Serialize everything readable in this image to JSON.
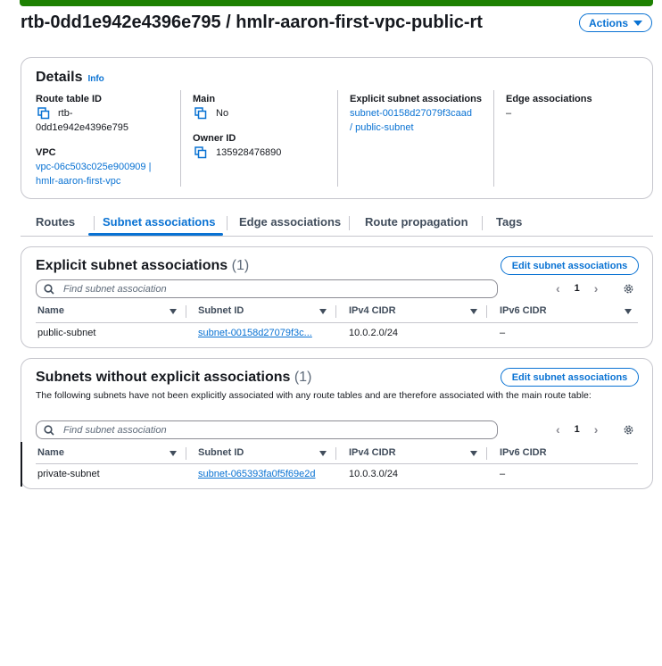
{
  "header": {
    "title": "rtb-0dd1e942e4396e795 / hmlr-aaron-first-vpc-public-rt",
    "actions_label": "Actions"
  },
  "details": {
    "heading": "Details",
    "info_label": "Info",
    "route_table_id_label": "Route table ID",
    "route_table_id_value_1": "rtb-",
    "route_table_id_value_2": "0dd1e942e4396e795",
    "vpc_label": "VPC",
    "vpc_value_1": "vpc-06c503c025e900909 |",
    "vpc_value_2": "hmlr-aaron-first-vpc",
    "main_label": "Main",
    "main_value": "No",
    "owner_id_label": "Owner ID",
    "owner_id_value": "135928476890",
    "explicit_label": "Explicit subnet associations",
    "explicit_value_1": "subnet-00158d27079f3caad",
    "explicit_value_2": "/ public-subnet",
    "edge_label": "Edge associations",
    "edge_value": "–"
  },
  "tabs": [
    "Routes",
    "Subnet associations",
    "Edge associations",
    "Route propagation",
    "Tags"
  ],
  "explicit_section": {
    "heading": "Explicit subnet associations",
    "count": "(1)",
    "edit_button": "Edit subnet associations",
    "search_placeholder": "Find subnet association",
    "page": "1",
    "columns": [
      "Name",
      "Subnet ID",
      "IPv4 CIDR",
      "IPv6 CIDR"
    ],
    "rows": [
      {
        "name": "public-subnet",
        "subnet_id": "subnet-00158d27079f3c...",
        "ipv4": "10.0.2.0/24",
        "ipv6": "–"
      }
    ]
  },
  "without_section": {
    "heading": "Subnets without explicit associations",
    "count": "(1)",
    "edit_button": "Edit subnet associations",
    "description": "The following subnets have not been explicitly associated with any route tables and are therefore associated with the main route table:",
    "search_placeholder": "Find subnet association",
    "page": "1",
    "columns": [
      "Name",
      "Subnet ID",
      "IPv4 CIDR",
      "IPv6 CIDR"
    ],
    "rows": [
      {
        "name": "private-subnet",
        "subnet_id": "subnet-065393fa0f5f69e2d",
        "ipv4": "10.0.3.0/24",
        "ipv6": "–"
      }
    ]
  },
  "colors": {
    "accent": "#0972d3",
    "success": "#1d8102",
    "text": "#16191f",
    "border": "#c6c6cd"
  }
}
